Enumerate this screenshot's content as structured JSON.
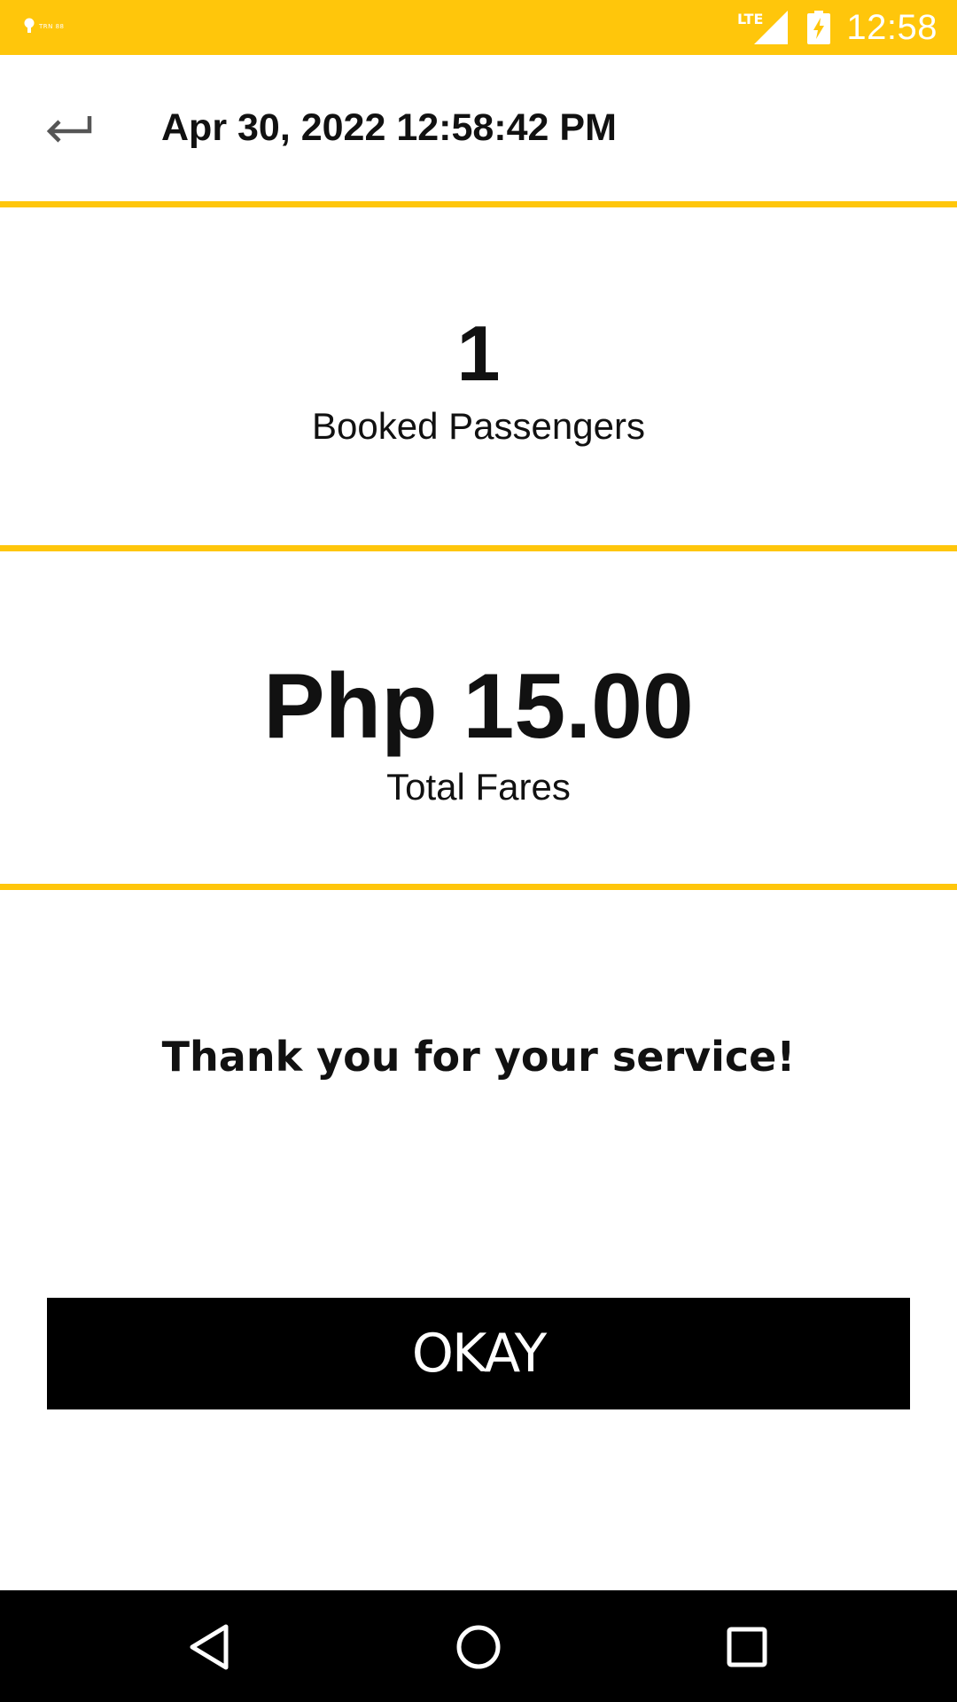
{
  "status_bar": {
    "notification_text": "TRN 88",
    "network": "LTE",
    "time": "12:58"
  },
  "app_bar": {
    "title": "Apr 30, 2022 12:58:42 PM",
    "back_icon": "back-arrow-icon"
  },
  "passengers": {
    "value": "1",
    "label": "Booked Passengers"
  },
  "fares": {
    "value": "Php 15.00",
    "label": "Total Fares"
  },
  "message": "Thank you for your service!",
  "okay_button": {
    "label": "OKAY"
  },
  "nav_bar": {
    "back_icon": "nav-back-icon",
    "home_icon": "nav-home-icon",
    "recents_icon": "nav-recents-icon"
  },
  "colors": {
    "accent": "#FFC60B",
    "button_bg": "#000000",
    "text": "#111111"
  }
}
